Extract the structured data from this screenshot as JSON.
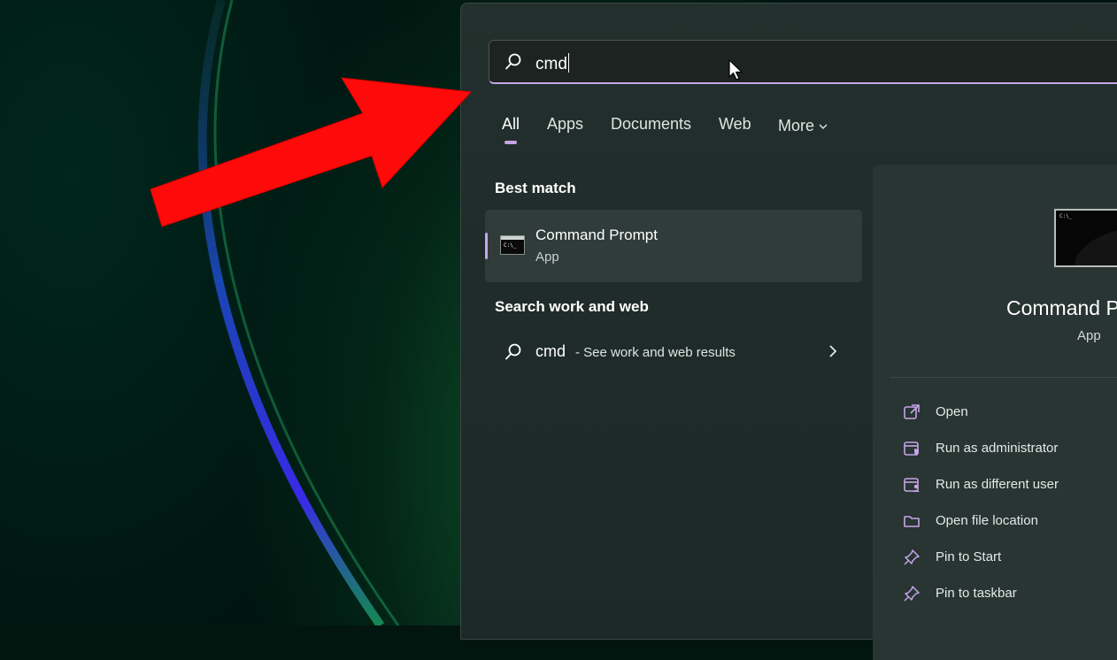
{
  "search": {
    "query": "cmd"
  },
  "tabs": [
    {
      "label": "All"
    },
    {
      "label": "Apps"
    },
    {
      "label": "Documents"
    },
    {
      "label": "Web"
    },
    {
      "label": "More"
    }
  ],
  "best_match": {
    "title": "Best match",
    "name": "Command Prompt",
    "type": "App"
  },
  "web_section": {
    "title": "Search work and web",
    "query": "cmd",
    "description": "- See work and web results"
  },
  "details": {
    "name": "Command P",
    "type": "App",
    "actions": [
      {
        "label": "Open",
        "icon": "open-external-icon"
      },
      {
        "label": "Run as administrator",
        "icon": "shield-window-icon"
      },
      {
        "label": "Run as different user",
        "icon": "user-window-icon"
      },
      {
        "label": "Open file location",
        "icon": "folder-icon"
      },
      {
        "label": "Pin to Start",
        "icon": "pin-icon"
      },
      {
        "label": "Pin to taskbar",
        "icon": "pin-icon"
      }
    ]
  },
  "colors": {
    "accent": "#c5a5e6",
    "panel": "#1f2c2a",
    "annotation_arrow": "#ff0a0a"
  }
}
